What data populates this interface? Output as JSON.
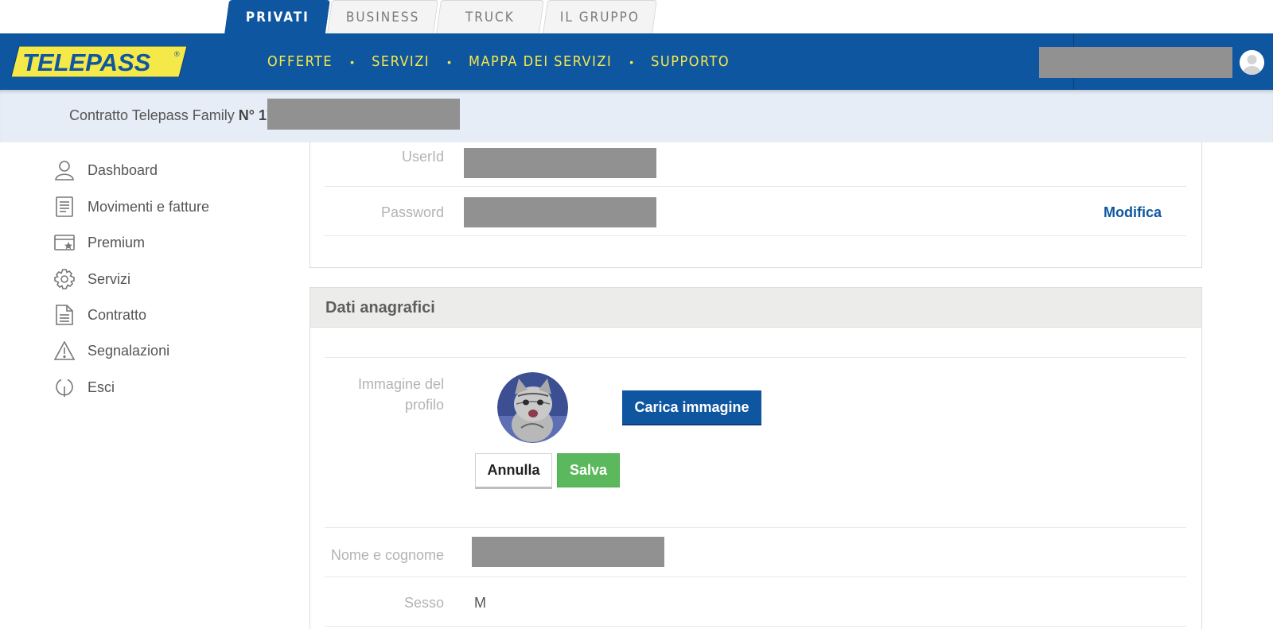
{
  "top_tabs": [
    {
      "label": "PRIVATI",
      "active": true
    },
    {
      "label": "BUSINESS",
      "active": false
    },
    {
      "label": "TRUCK",
      "active": false
    },
    {
      "label": "IL GRUPPO",
      "active": false
    }
  ],
  "header": {
    "logo_text": "TELEPASS",
    "logo_mark": "®",
    "nav": [
      "OFFERTE",
      "SERVIZI",
      "MAPPA DEI SERVIZI",
      "SUPPORTO"
    ],
    "nav_separator": "•"
  },
  "contract": {
    "prefix": "Contratto Telepass Family ",
    "number_label": "N° 17"
  },
  "sidebar": {
    "items": [
      {
        "label": "Dashboard",
        "icon": "user-icon"
      },
      {
        "label": "Movimenti e fatture",
        "icon": "receipt-icon"
      },
      {
        "label": "Premium",
        "icon": "premium-card-icon"
      },
      {
        "label": "Servizi",
        "icon": "gear-icon"
      },
      {
        "label": "Contratto",
        "icon": "document-icon"
      },
      {
        "label": "Segnalazioni",
        "icon": "warning-icon"
      },
      {
        "label": "Esci",
        "icon": "logout-icon"
      }
    ]
  },
  "credentials": {
    "userid_label": "UserId",
    "password_label": "Password",
    "edit_label": "Modifica"
  },
  "anagrafica": {
    "title": "Dati anagrafici",
    "profile_image_label": "Immagine del profilo",
    "upload_button": "Carica immagine",
    "cancel_button": "Annulla",
    "save_button": "Salva",
    "name_label": "Nome e cognome",
    "sex_label": "Sesso",
    "sex_value": "M"
  },
  "colors": {
    "brand_blue": "#0f56a0",
    "brand_yellow": "#f5e94a",
    "save_green": "#5cb85c",
    "redaction_gray": "#919191"
  }
}
